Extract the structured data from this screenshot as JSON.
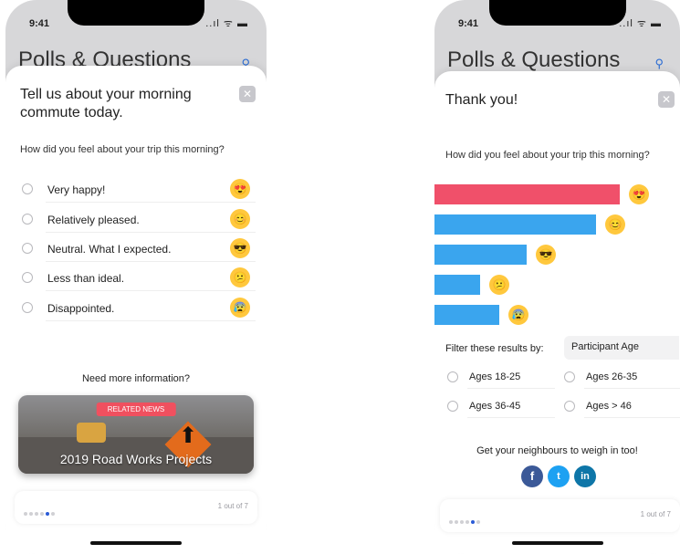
{
  "left": {
    "status_time": "9:41",
    "status_icons": "..ıl ᯤ ▬",
    "bg_title": "Polls & Questions",
    "search_icon": "⚲",
    "title": "Tell us about your morning commute today.",
    "close_icon": "✕",
    "question": "How did you feel about your trip this morning?",
    "options": [
      {
        "label": "Very happy!",
        "emoji": "😍"
      },
      {
        "label": "Relatively pleased.",
        "emoji": "😊"
      },
      {
        "label": "Neutral. What I expected.",
        "emoji": "😎"
      },
      {
        "label": "Less than ideal.",
        "emoji": "😕"
      },
      {
        "label": "Disappointed.",
        "emoji": "😰"
      }
    ],
    "more_info": "Need more information?",
    "news_badge": "RELATED NEWS",
    "news_title": "2019 Road Works Projects",
    "page_count": "1 out of 7"
  },
  "right": {
    "status_time": "9:41",
    "status_icons": "..ıl ᯤ ▬",
    "bg_title": "Polls & Questions",
    "search_icon": "⚲",
    "title": "Thank you!",
    "close_icon": "✕",
    "question": "How did you feel about your trip this morning?",
    "results": [
      {
        "value": 203,
        "color": "#f0506a",
        "emoji": "😍"
      },
      {
        "value": 177,
        "color": "#3aa5ee",
        "emoji": "😊"
      },
      {
        "value": 101,
        "color": "#3aa5ee",
        "emoji": "😎"
      },
      {
        "value": 50,
        "color": "#3aa5ee",
        "emoji": "😕"
      },
      {
        "value": 71,
        "color": "#3aa5ee",
        "emoji": "😰"
      }
    ],
    "filter_label": "Filter these results by:",
    "filter_value": "Participant Age",
    "ages": [
      "Ages 18-25",
      "Ages 26-35",
      "Ages 36-45",
      "Ages > 46"
    ],
    "share_label": "Get your neighbours to weigh in too!",
    "social": {
      "facebook": "f",
      "twitter": "t",
      "linkedin": "in"
    },
    "page_count": "1 out of 7"
  },
  "colors": {
    "accent": "#2b5bd6",
    "badge": "#f0505f",
    "emoji": "#ffc83d"
  }
}
